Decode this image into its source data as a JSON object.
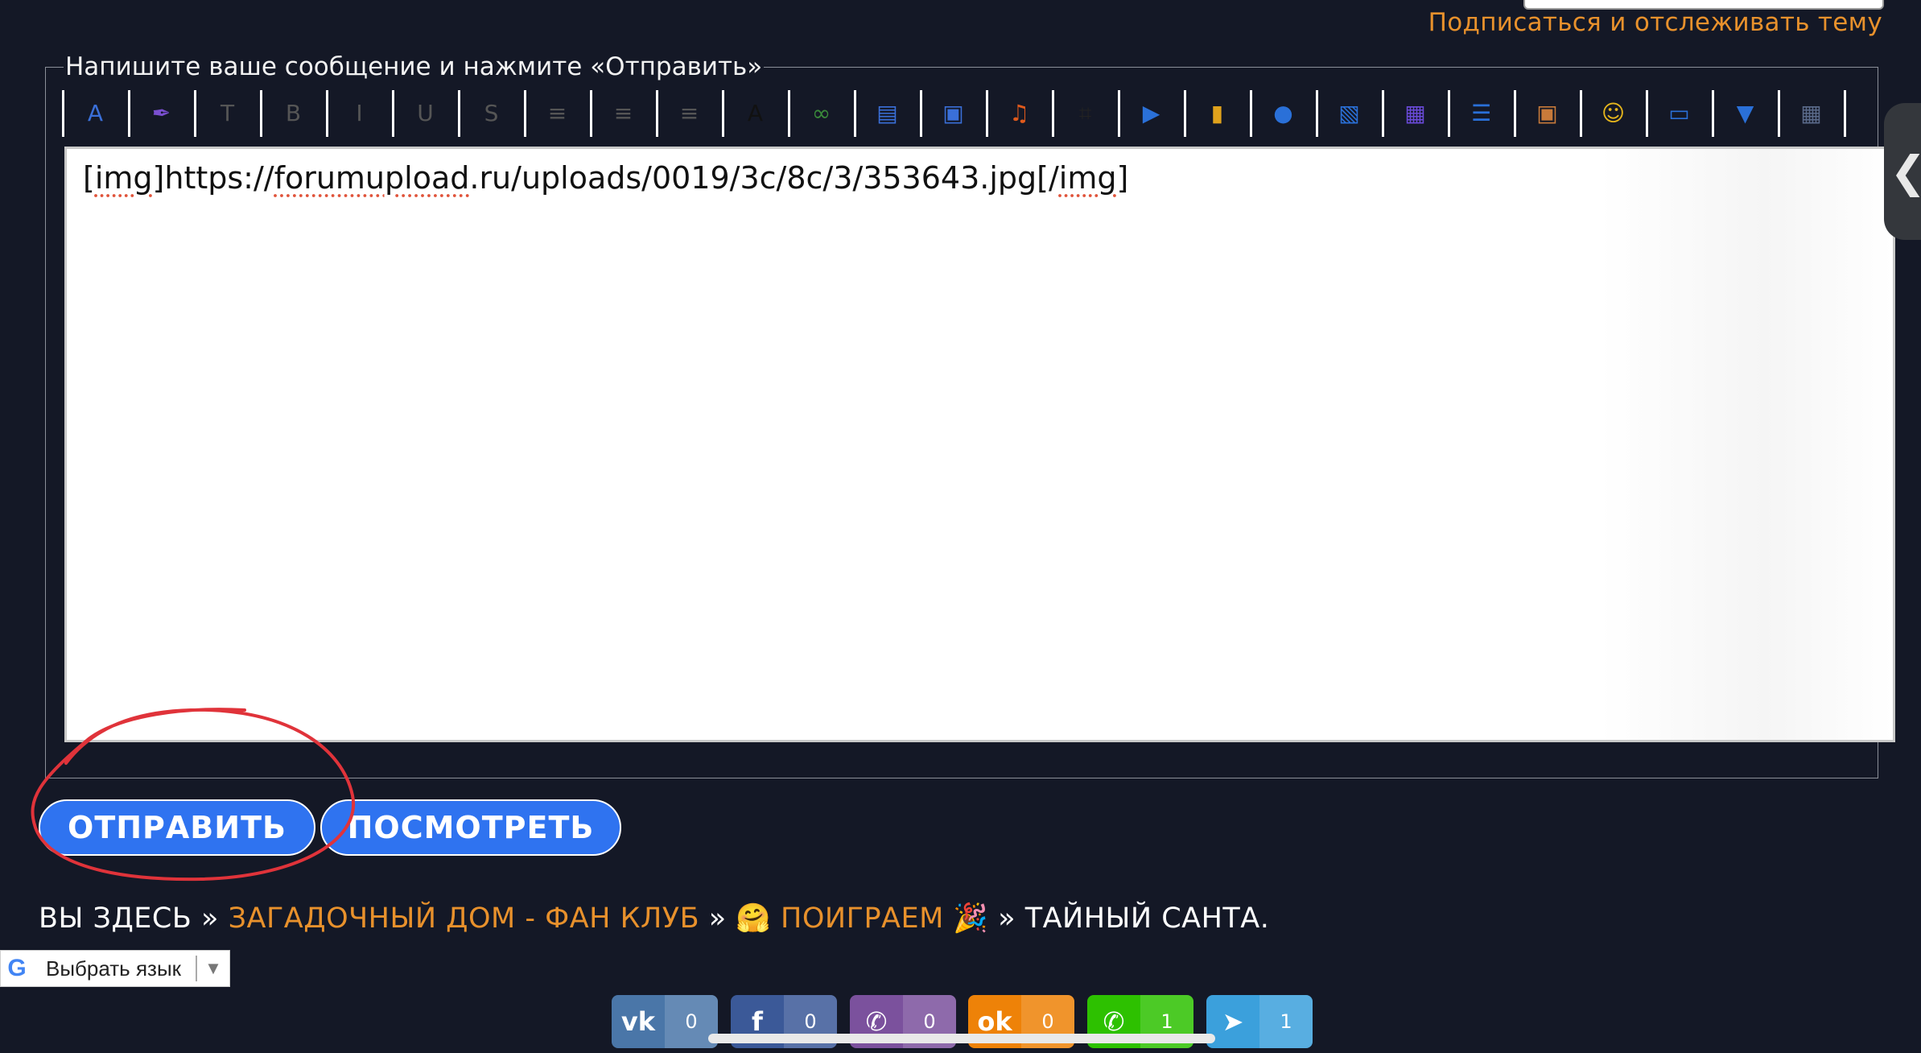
{
  "topbar": {
    "subscribe_link": "Подписаться и отслеживать тему"
  },
  "editor": {
    "legend": "Напишите ваше сообщение и нажмите «Отправить»",
    "content_parts": [
      "[",
      "img",
      "]https://",
      "forumupload",
      ".ru/uploads/0019/3c/8c/3/353643.jpg[/",
      "img",
      "]"
    ],
    "toolbar": [
      {
        "name": "font-icon",
        "glyph": "A",
        "color": "#3a6fd8"
      },
      {
        "name": "quill-icon",
        "glyph": "✒",
        "color": "#7a4fd0"
      },
      {
        "name": "font-size-icon",
        "glyph": "T",
        "color": "#555555"
      },
      {
        "name": "bold-icon",
        "glyph": "B",
        "color": "#555555"
      },
      {
        "name": "italic-icon",
        "glyph": "I",
        "color": "#555555"
      },
      {
        "name": "underline-icon",
        "glyph": "U",
        "color": "#555555"
      },
      {
        "name": "strikethrough-icon",
        "glyph": "S",
        "color": "#555555"
      },
      {
        "name": "align-left-icon",
        "glyph": "≡",
        "color": "#555555"
      },
      {
        "name": "align-center-icon",
        "glyph": "≡",
        "color": "#555555"
      },
      {
        "name": "align-right-icon",
        "glyph": "≡",
        "color": "#555555"
      },
      {
        "name": "text-color-icon",
        "glyph": "A",
        "color": "#111111"
      },
      {
        "name": "link-icon",
        "glyph": "∞",
        "color": "#3a8a3a"
      },
      {
        "name": "book-icon",
        "glyph": "▤",
        "color": "#3a6fd8"
      },
      {
        "name": "gallery-icon",
        "glyph": "▣",
        "color": "#3a6fd8"
      },
      {
        "name": "headphones-icon",
        "glyph": "♫",
        "color": "#e05a1c"
      },
      {
        "name": "crop-icon",
        "glyph": "⌗",
        "color": "#222222"
      },
      {
        "name": "play-icon",
        "glyph": "▶",
        "color": "#2a70d8"
      },
      {
        "name": "lock-icon",
        "glyph": "▮",
        "color": "#e0a21c"
      },
      {
        "name": "speech-bubble-icon",
        "glyph": "●",
        "color": "#2a70d8"
      },
      {
        "name": "document-icon",
        "glyph": "▧",
        "color": "#2a70d8"
      },
      {
        "name": "table-icon",
        "glyph": "▦",
        "color": "#6a4ad8"
      },
      {
        "name": "list-icon",
        "glyph": "☰",
        "color": "#2a70d8"
      },
      {
        "name": "photo-upload-icon",
        "glyph": "▣",
        "color": "#c87a3a"
      },
      {
        "name": "smiley-icon",
        "glyph": "☺",
        "color": "#e5b51c"
      },
      {
        "name": "keyboard-icon",
        "glyph": "▭",
        "color": "#2a70d8"
      },
      {
        "name": "more-dropdown-icon",
        "glyph": "▼",
        "color": "#2a70d8"
      },
      {
        "name": "layout-icon",
        "glyph": "▦",
        "color": "#5a6a8a"
      }
    ]
  },
  "actions": {
    "submit_label": "ОТПРАВИТЬ",
    "preview_label": "ПОСМОТРЕТЬ",
    "button_color": "#2f73f0"
  },
  "breadcrumb": {
    "prefix": "ВЫ ЗДЕСЬ",
    "separator": "»",
    "crumb1": "ЗАГАДОЧНЫЙ ДОМ - ФАН КЛУБ",
    "crumb2": "🤗 ПОИГРАЕМ 🎉",
    "current": "ТАЙНЫЙ САНТА.",
    "link_color": "#e8912c"
  },
  "translate": {
    "label": "Выбрать язык",
    "arrow": "▼"
  },
  "share": [
    {
      "network": "vk",
      "icon_name": "vk-icon",
      "glyph": "vk",
      "count": "0",
      "color": "#4a76a8"
    },
    {
      "network": "facebook",
      "icon_name": "facebook-icon",
      "glyph": "f",
      "count": "0",
      "color": "#3b5998"
    },
    {
      "network": "viber",
      "icon_name": "viber-icon",
      "glyph": "✆",
      "count": "0",
      "color": "#7b519d"
    },
    {
      "network": "odnoklassniki",
      "icon_name": "odnoklassniki-icon",
      "glyph": "ok",
      "count": "0",
      "color": "#ee8208"
    },
    {
      "network": "whatsapp",
      "icon_name": "whatsapp-icon",
      "glyph": "✆",
      "count": "1",
      "color": "#2dc100"
    },
    {
      "network": "telegram",
      "icon_name": "telegram-icon",
      "glyph": "➤",
      "count": "1",
      "color": "#3ba0dc"
    }
  ]
}
